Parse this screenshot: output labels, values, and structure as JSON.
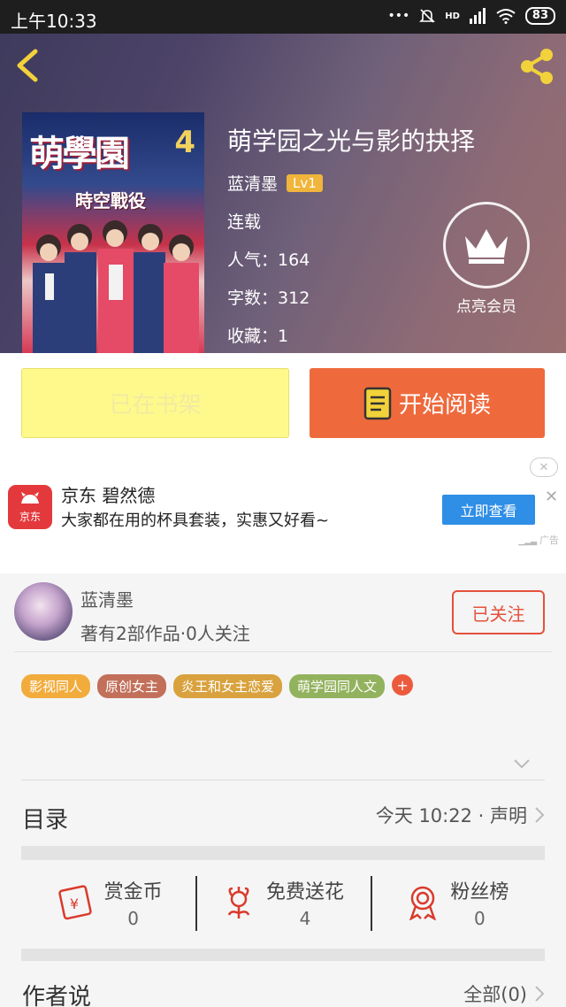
{
  "status_bar": {
    "time": "上午10:33",
    "signal_label": "HD",
    "battery": "83"
  },
  "book": {
    "title": "萌学园之光与影的抉择",
    "author": "蓝清墨",
    "author_level": "Lv1",
    "status": "连载",
    "popularity_label": "人气：",
    "popularity": "164",
    "words_label": "字数：",
    "words": "312",
    "favorites_label": "收藏：",
    "favorites": "1",
    "cover_title": "萌學園",
    "cover_subtitle": "時空戰役",
    "cover_number": "4"
  },
  "vip": {
    "label": "点亮会员"
  },
  "actions": {
    "shelf_label": "已在书架",
    "read_label": "开始阅读"
  },
  "ad": {
    "logo_text": "京东",
    "title": "京东 碧然德",
    "description": "大家都在用的杯具套装，实惠又好看~",
    "button": "立即查看",
    "tag": "广告"
  },
  "author_card": {
    "name": "蓝清墨",
    "stats": "著有2部作品·0人关注",
    "follow_label": "已关注"
  },
  "tags": [
    {
      "label": "影视同人",
      "color": "#f2ac3c"
    },
    {
      "label": "原创女主",
      "color": "#c2705a"
    },
    {
      "label": "炎王和女主恋爱",
      "color": "#d9a23e"
    },
    {
      "label": "萌学园同人文",
      "color": "#93b25e"
    }
  ],
  "toc": {
    "label": "目录",
    "updated": "今天 10:22 · 声明"
  },
  "rewards": [
    {
      "label": "赏金币",
      "count": "0",
      "icon": "red-envelope-icon"
    },
    {
      "label": "免费送花",
      "count": "4",
      "icon": "flower-icon"
    },
    {
      "label": "粉丝榜",
      "count": "0",
      "icon": "medal-icon"
    }
  ],
  "author_says": {
    "label": "作者说",
    "all_label": "全部(0)"
  },
  "colors": {
    "accent": "#ee6a3c",
    "shelf_button": "#fff98c",
    "follow": "#e4513c",
    "ad_button": "#2f8ee6"
  }
}
